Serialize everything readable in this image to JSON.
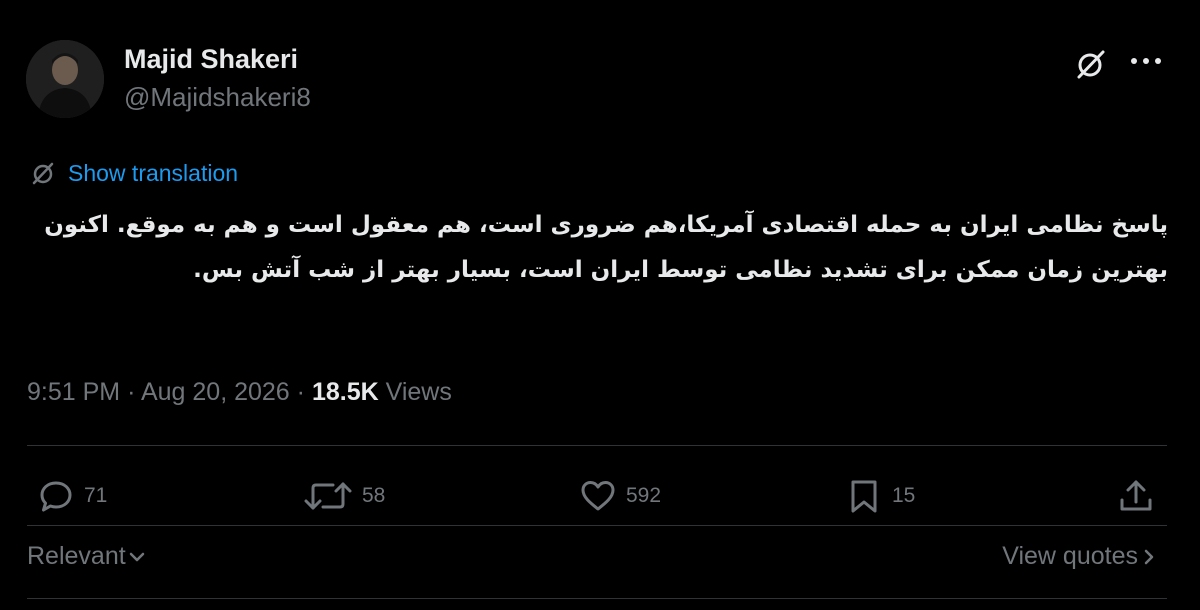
{
  "author": {
    "name": "Majid Shakeri",
    "handle": "@Majidshakeri8",
    "avatar_icon": "avatar-photo"
  },
  "header_icons": [
    "grok-icon",
    "more-icon"
  ],
  "translation": {
    "label": "Show translation",
    "icon": "translate-icon"
  },
  "tweet": {
    "text": "پاسخ نظامی ایران به حمله اقتصادی آمریکا،هم ضروری است، هم معقول است و هم به موقع. اکنون بهترین زمان ممکن برای تشدید نظامی توسط ایران است، بسیار بهتر از شب آتش بس."
  },
  "meta": {
    "time": "9:51 PM",
    "date": "Aug 20, 2026",
    "separator": "·",
    "views_count": "18.5K",
    "views_label": "Views"
  },
  "actions": {
    "replies": "71",
    "reposts": "58",
    "likes": "592",
    "bookmarks": "15"
  },
  "footer": {
    "sort_label": "Relevant",
    "quotes_label": "View quotes"
  },
  "colors": {
    "background": "#000000",
    "text": "#e7e9ea",
    "secondary": "#71767b",
    "link": "#1d9bf0",
    "divider": "#2f3336"
  }
}
